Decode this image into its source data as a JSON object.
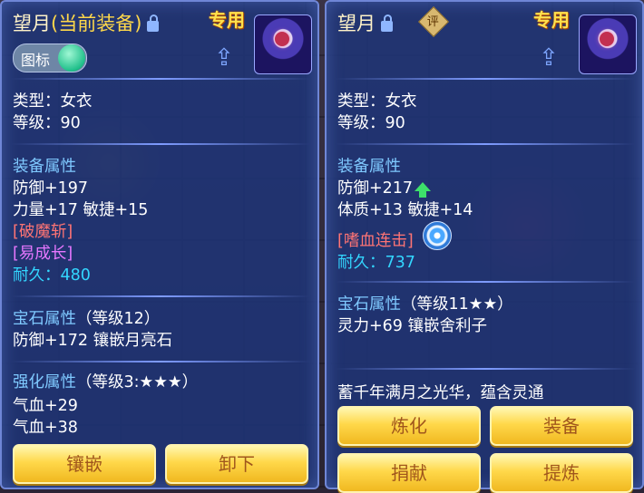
{
  "left": {
    "title_name": "望月",
    "title_status": "(当前装备)",
    "special_label": "专用",
    "toggle_label": "图标",
    "type_line": "类型：女衣",
    "level_line": "等级：90",
    "equip_attr_heading": "装备属性",
    "defense": "防御+197",
    "stats_line": "力量+17 敏捷+15",
    "effect_1": "[破魔斩]",
    "effect_2": "[易成长]",
    "durability_label": "耐久：",
    "durability_value": "480",
    "gem_heading": "宝石属性",
    "gem_level": "（等级12）",
    "gem_line": "防御+172 镶嵌月亮石",
    "enhance_heading": "强化属性",
    "enhance_level": "（等级3:★★★）",
    "enhance_line_1": "气血+29",
    "enhance_line_2": "气血+38",
    "buttons": [
      "镶嵌",
      "卸下"
    ]
  },
  "right": {
    "title_name": "望月",
    "rating_label": "评",
    "special_label": "专用",
    "type_line": "类型：女衣",
    "level_line": "等级：90",
    "equip_attr_heading": "装备属性",
    "defense": "防御+217",
    "stats_line": "体质+13 敏捷+14",
    "effect_1": "[嗜血连击]",
    "durability_label": "耐久：",
    "durability_value": "737",
    "gem_heading": "宝石属性",
    "gem_level": "（等级11★★）",
    "gem_line": "灵力+69 镶嵌舍利子",
    "description": "蓄千年满月之光华，蕴含灵通",
    "buttons": [
      "炼化",
      "装备",
      "捐献",
      "提炼"
    ]
  },
  "colors": {
    "panel": "#1e3478",
    "heading": "#7fc9ff",
    "effect_red": "#ff7474",
    "effect_magenta": "#e677ff",
    "durability": "#33d6ff",
    "special": "#ffe14d",
    "button": "#ffd84a",
    "button_text": "#a0561c"
  },
  "icons": [
    "lock-icon",
    "share-icon",
    "rating-icon",
    "up-arrow-icon",
    "swirl-skill-icon",
    "character-avatar"
  ]
}
